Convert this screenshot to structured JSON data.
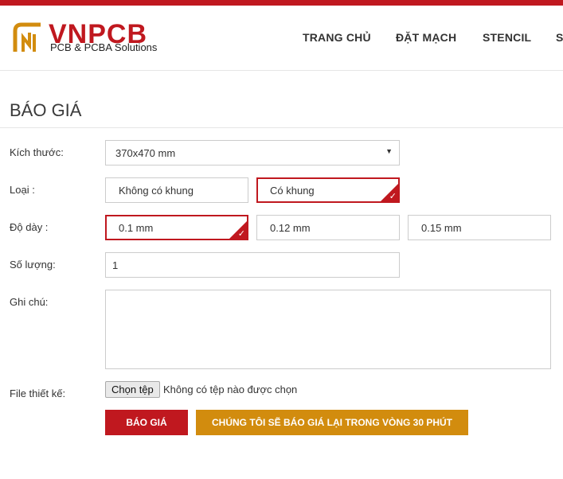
{
  "colors": {
    "brand_red": "#c0181f",
    "brand_gold": "#d28c0e"
  },
  "header": {
    "logo": {
      "name": "VNPCB",
      "tagline": "PCB & PCBA Solutions",
      "icon": "vnpcb-logo-icon"
    },
    "nav": [
      {
        "label": "TRANG CHỦ"
      },
      {
        "label": "ĐẶT MẠCH"
      },
      {
        "label": "STENCIL"
      },
      {
        "label": "S"
      }
    ]
  },
  "page": {
    "title": "BÁO GIÁ"
  },
  "form": {
    "size": {
      "label": "Kích thước:",
      "value": "370x470 mm",
      "icon": "dropdown-arrow-icon"
    },
    "type": {
      "label": "Loại :",
      "options": [
        {
          "label": "Không có khung",
          "selected": false
        },
        {
          "label": "Có khung",
          "selected": true
        }
      ]
    },
    "thickness": {
      "label": "Độ dày :",
      "options": [
        {
          "label": "0.1 mm",
          "selected": true
        },
        {
          "label": "0.12 mm",
          "selected": false
        },
        {
          "label": "0.15 mm",
          "selected": false
        }
      ]
    },
    "quantity": {
      "label": "Số lượng:",
      "value": "1"
    },
    "notes": {
      "label": "Ghi chú:",
      "value": ""
    },
    "file": {
      "label": "File thiết kế:",
      "button": "Chọn tệp",
      "status": "Không có tệp nào được chọn"
    }
  },
  "actions": {
    "quote_button": "BÁO GIÁ",
    "callback_button": "CHÚNG TÔI SẼ BÁO GIÁ LẠI TRONG VÒNG 30 PHÚT"
  }
}
